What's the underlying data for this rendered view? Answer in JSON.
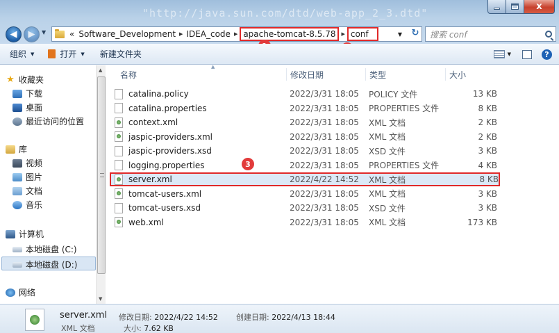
{
  "window": {
    "blurred_title": "\"http://java.sun.com/dtd/web-app_2_3.dtd\"",
    "caption": {
      "minimize": "minimize",
      "maximize": "maximize",
      "close": "x"
    }
  },
  "address": {
    "prefix": "«",
    "crumbs": [
      "Software_Development",
      "IDEA_code",
      "apache-tomcat-8.5.78",
      "conf"
    ],
    "highlighted": [
      "apache-tomcat-8.5.78",
      "conf"
    ],
    "refresh": "↻"
  },
  "search": {
    "placeholder": "搜索 conf"
  },
  "badges": [
    "1",
    "2",
    "3"
  ],
  "toolbar": {
    "organize": "组织",
    "open": "打开",
    "new_folder": "新建文件夹"
  },
  "nav": {
    "favorites": "收藏夹",
    "downloads": "下载",
    "desktop": "桌面",
    "recent": "最近访问的位置",
    "libraries": "库",
    "videos": "视频",
    "pictures": "图片",
    "documents": "文档",
    "music": "音乐",
    "computer": "计算机",
    "disk_c": "本地磁盘 (C:)",
    "disk_d": "本地磁盘 (D:)",
    "network": "网络"
  },
  "columns": {
    "name": "名称",
    "date": "修改日期",
    "type": "类型",
    "size": "大小"
  },
  "files": [
    {
      "name": "catalina.policy",
      "date": "2022/3/31 18:05",
      "type": "POLICY 文件",
      "size": "13 KB",
      "icon": "file-icon"
    },
    {
      "name": "catalina.properties",
      "date": "2022/3/31 18:05",
      "type": "PROPERTIES 文件",
      "size": "8 KB",
      "icon": "file-icon"
    },
    {
      "name": "context.xml",
      "date": "2022/3/31 18:05",
      "type": "XML 文档",
      "size": "2 KB",
      "icon": "xml-file-icon"
    },
    {
      "name": "jaspic-providers.xml",
      "date": "2022/3/31 18:05",
      "type": "XML 文档",
      "size": "2 KB",
      "icon": "xml-file-icon"
    },
    {
      "name": "jaspic-providers.xsd",
      "date": "2022/3/31 18:05",
      "type": "XSD 文件",
      "size": "3 KB",
      "icon": "file-icon"
    },
    {
      "name": "logging.properties",
      "date": "2022/3/31 18:05",
      "type": "PROPERTIES 文件",
      "size": "4 KB",
      "icon": "file-icon"
    },
    {
      "name": "server.xml",
      "date": "2022/4/22 14:52",
      "type": "XML 文档",
      "size": "8 KB",
      "icon": "xml-file-icon",
      "selected": true
    },
    {
      "name": "tomcat-users.xml",
      "date": "2022/3/31 18:05",
      "type": "XML 文档",
      "size": "3 KB",
      "icon": "xml-file-icon"
    },
    {
      "name": "tomcat-users.xsd",
      "date": "2022/3/31 18:05",
      "type": "XSD 文件",
      "size": "3 KB",
      "icon": "file-icon"
    },
    {
      "name": "web.xml",
      "date": "2022/3/31 18:05",
      "type": "XML 文档",
      "size": "173 KB",
      "icon": "xml-file-icon"
    }
  ],
  "details": {
    "name": "server.xml",
    "type": "XML 文档",
    "modified_label": "修改日期:",
    "modified": "2022/4/22 14:52",
    "created_label": "创建日期:",
    "created": "2022/4/13 18:44",
    "size_label": "大小:",
    "size": "7.62 KB"
  },
  "colors": {
    "highlight": "#e02929",
    "badge": "#e23b3b",
    "selection": "#dce9f7"
  }
}
